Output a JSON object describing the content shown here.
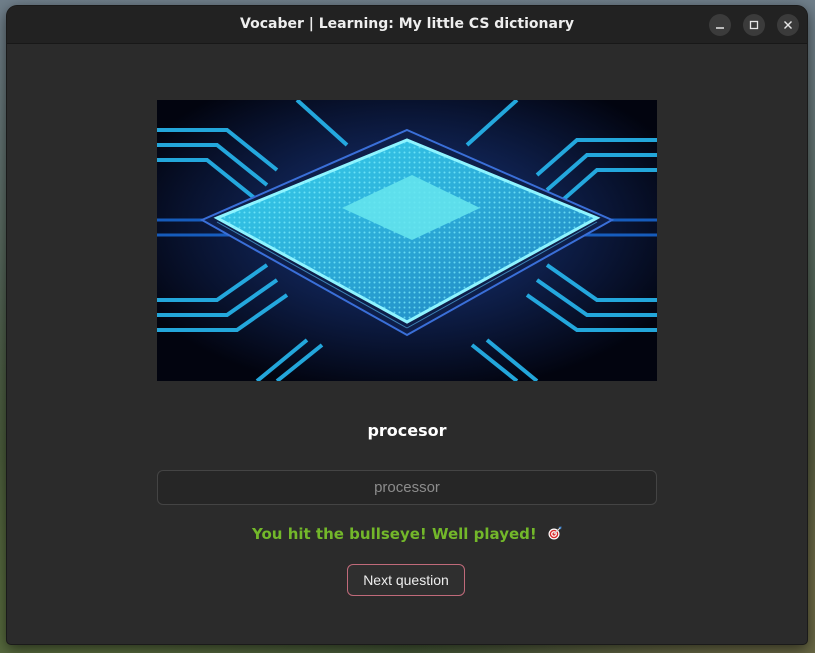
{
  "window": {
    "title": "Vocaber | Learning: My little CS dictionary"
  },
  "controls": {
    "minimize_icon": "minimize-icon",
    "maximize_icon": "maximize-icon",
    "close_icon": "close-icon"
  },
  "quiz": {
    "image_subject": "cpu-chip-image",
    "word": "procesor",
    "answer_value": "processor",
    "feedback": "You hit the bullseye! Well played!",
    "feedback_icon": "bullseye-emoji",
    "next_label": "Next question"
  },
  "colors": {
    "feedback": "#73b82a",
    "next_border": "#c06a7a",
    "window_bg": "#2b2b2b",
    "titlebar_bg": "#222222"
  }
}
